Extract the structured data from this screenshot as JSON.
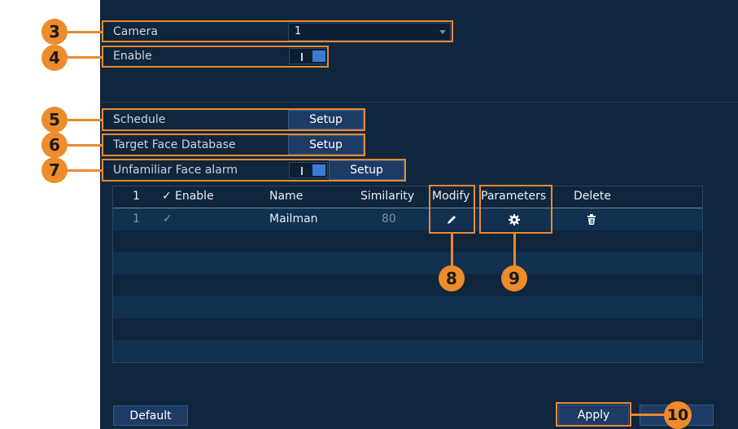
{
  "camera": {
    "label": "Camera",
    "value": "1"
  },
  "enable": {
    "label": "Enable",
    "on": true
  },
  "schedule": {
    "label": "Schedule",
    "button": "Setup"
  },
  "target_face": {
    "label": "Target Face Database",
    "button": "Setup"
  },
  "unfamiliar": {
    "label": "Unfamiliar Face alarm",
    "on": true,
    "button": "Setup"
  },
  "table": {
    "headers": {
      "index": "1",
      "enable": "Enable",
      "name": "Name",
      "similarity": "Similarity",
      "modify": "Modify",
      "parameters": "Parameters",
      "delete": "Delete"
    },
    "rows": [
      {
        "index": "1",
        "name": "Mailman",
        "similarity": "80",
        "enabled": true
      }
    ],
    "check_glyph": "✓"
  },
  "buttons": {
    "default": "Default",
    "apply": "Apply"
  },
  "callouts": [
    "3",
    "4",
    "5",
    "6",
    "7",
    "8",
    "9",
    "10"
  ],
  "colors": {
    "panel": "#10263d",
    "accent": "#e88a2f",
    "button": "#1e3b66",
    "toggle_on": "#3a7bd5"
  }
}
